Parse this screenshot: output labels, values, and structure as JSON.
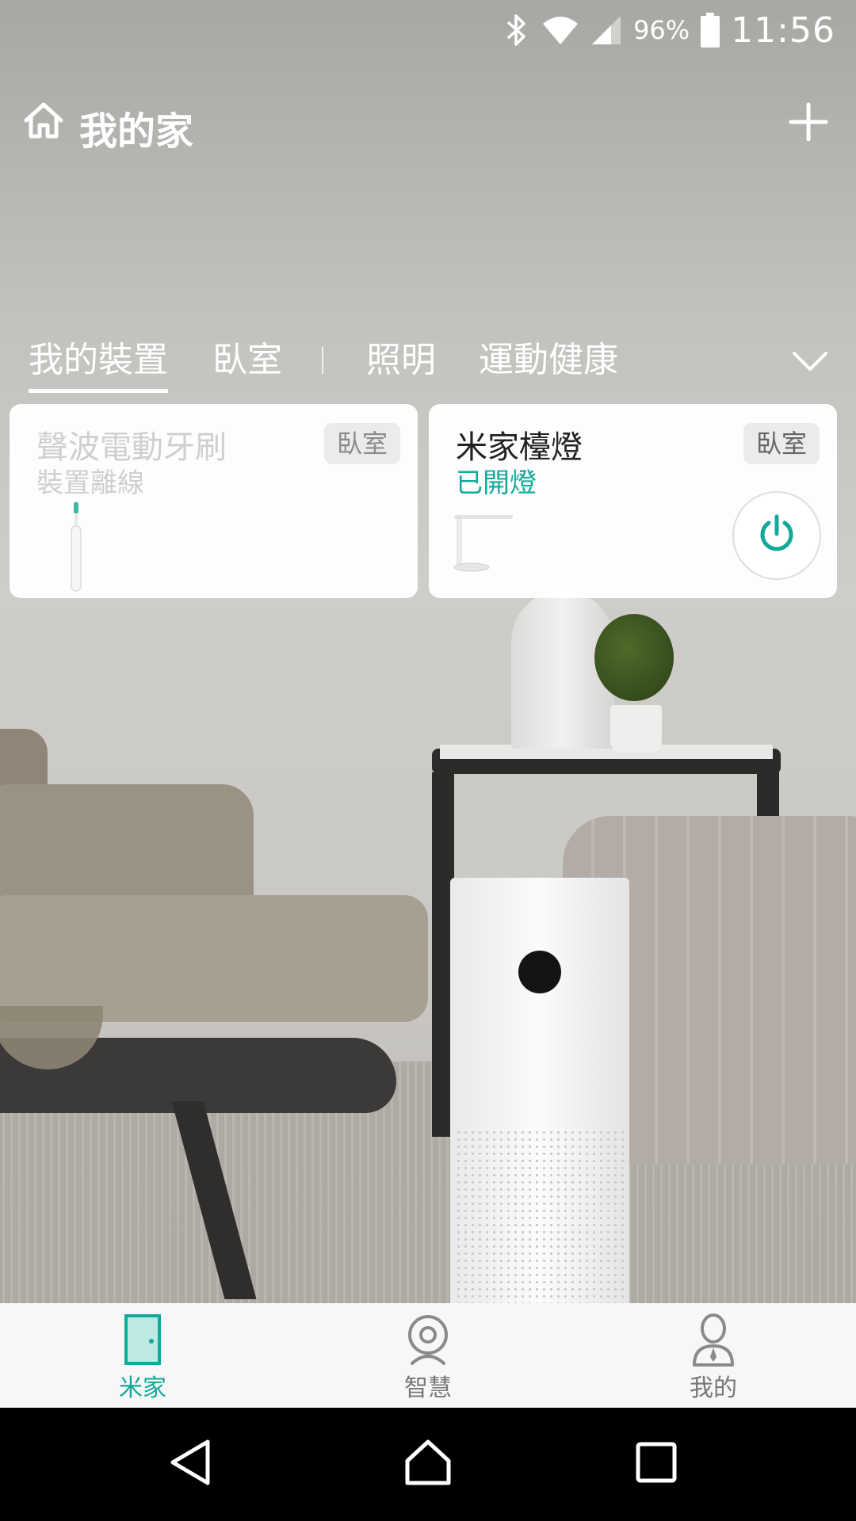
{
  "status_bar": {
    "battery_percent": "96%",
    "time": "11:56",
    "icons": [
      "bluetooth-icon",
      "wifi-icon",
      "signal-icon",
      "battery-icon"
    ]
  },
  "header": {
    "title": "我的家",
    "home_icon": "home-icon",
    "add_icon": "plus-icon"
  },
  "tabs": [
    {
      "label": "我的裝置",
      "active": true
    },
    {
      "label": "臥室",
      "active": false
    },
    {
      "label": "照明",
      "active": false
    },
    {
      "label": "運動健康",
      "active": false
    }
  ],
  "devices": [
    {
      "name": "聲波電動牙刷",
      "status": "裝置離線",
      "room": "臥室",
      "online": false
    },
    {
      "name": "米家檯燈",
      "status": "已開燈",
      "room": "臥室",
      "online": true
    }
  ],
  "bottom_nav": [
    {
      "label": "米家",
      "icon": "door-icon",
      "active": true
    },
    {
      "label": "智慧",
      "icon": "camera-icon",
      "active": false
    },
    {
      "label": "我的",
      "icon": "profile-icon",
      "active": false
    }
  ],
  "colors": {
    "accent": "#13a99a",
    "nav_background": "#f7f7f7",
    "system_nav": "#000000"
  }
}
